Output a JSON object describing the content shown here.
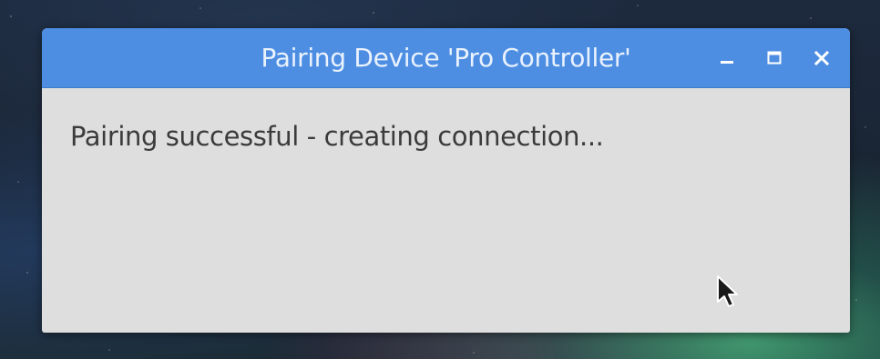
{
  "dialog": {
    "title": "Pairing Device 'Pro Controller'",
    "message": "Pairing successful - creating connection..."
  },
  "controls": {
    "minimize_icon": "minimize-icon",
    "maximize_icon": "maximize-icon",
    "close_icon": "close-icon"
  },
  "colors": {
    "titlebar": "#4d8ee3",
    "window_bg": "#dedede",
    "title_text": "#eaf2fd",
    "message_text": "#3b3b3b"
  }
}
